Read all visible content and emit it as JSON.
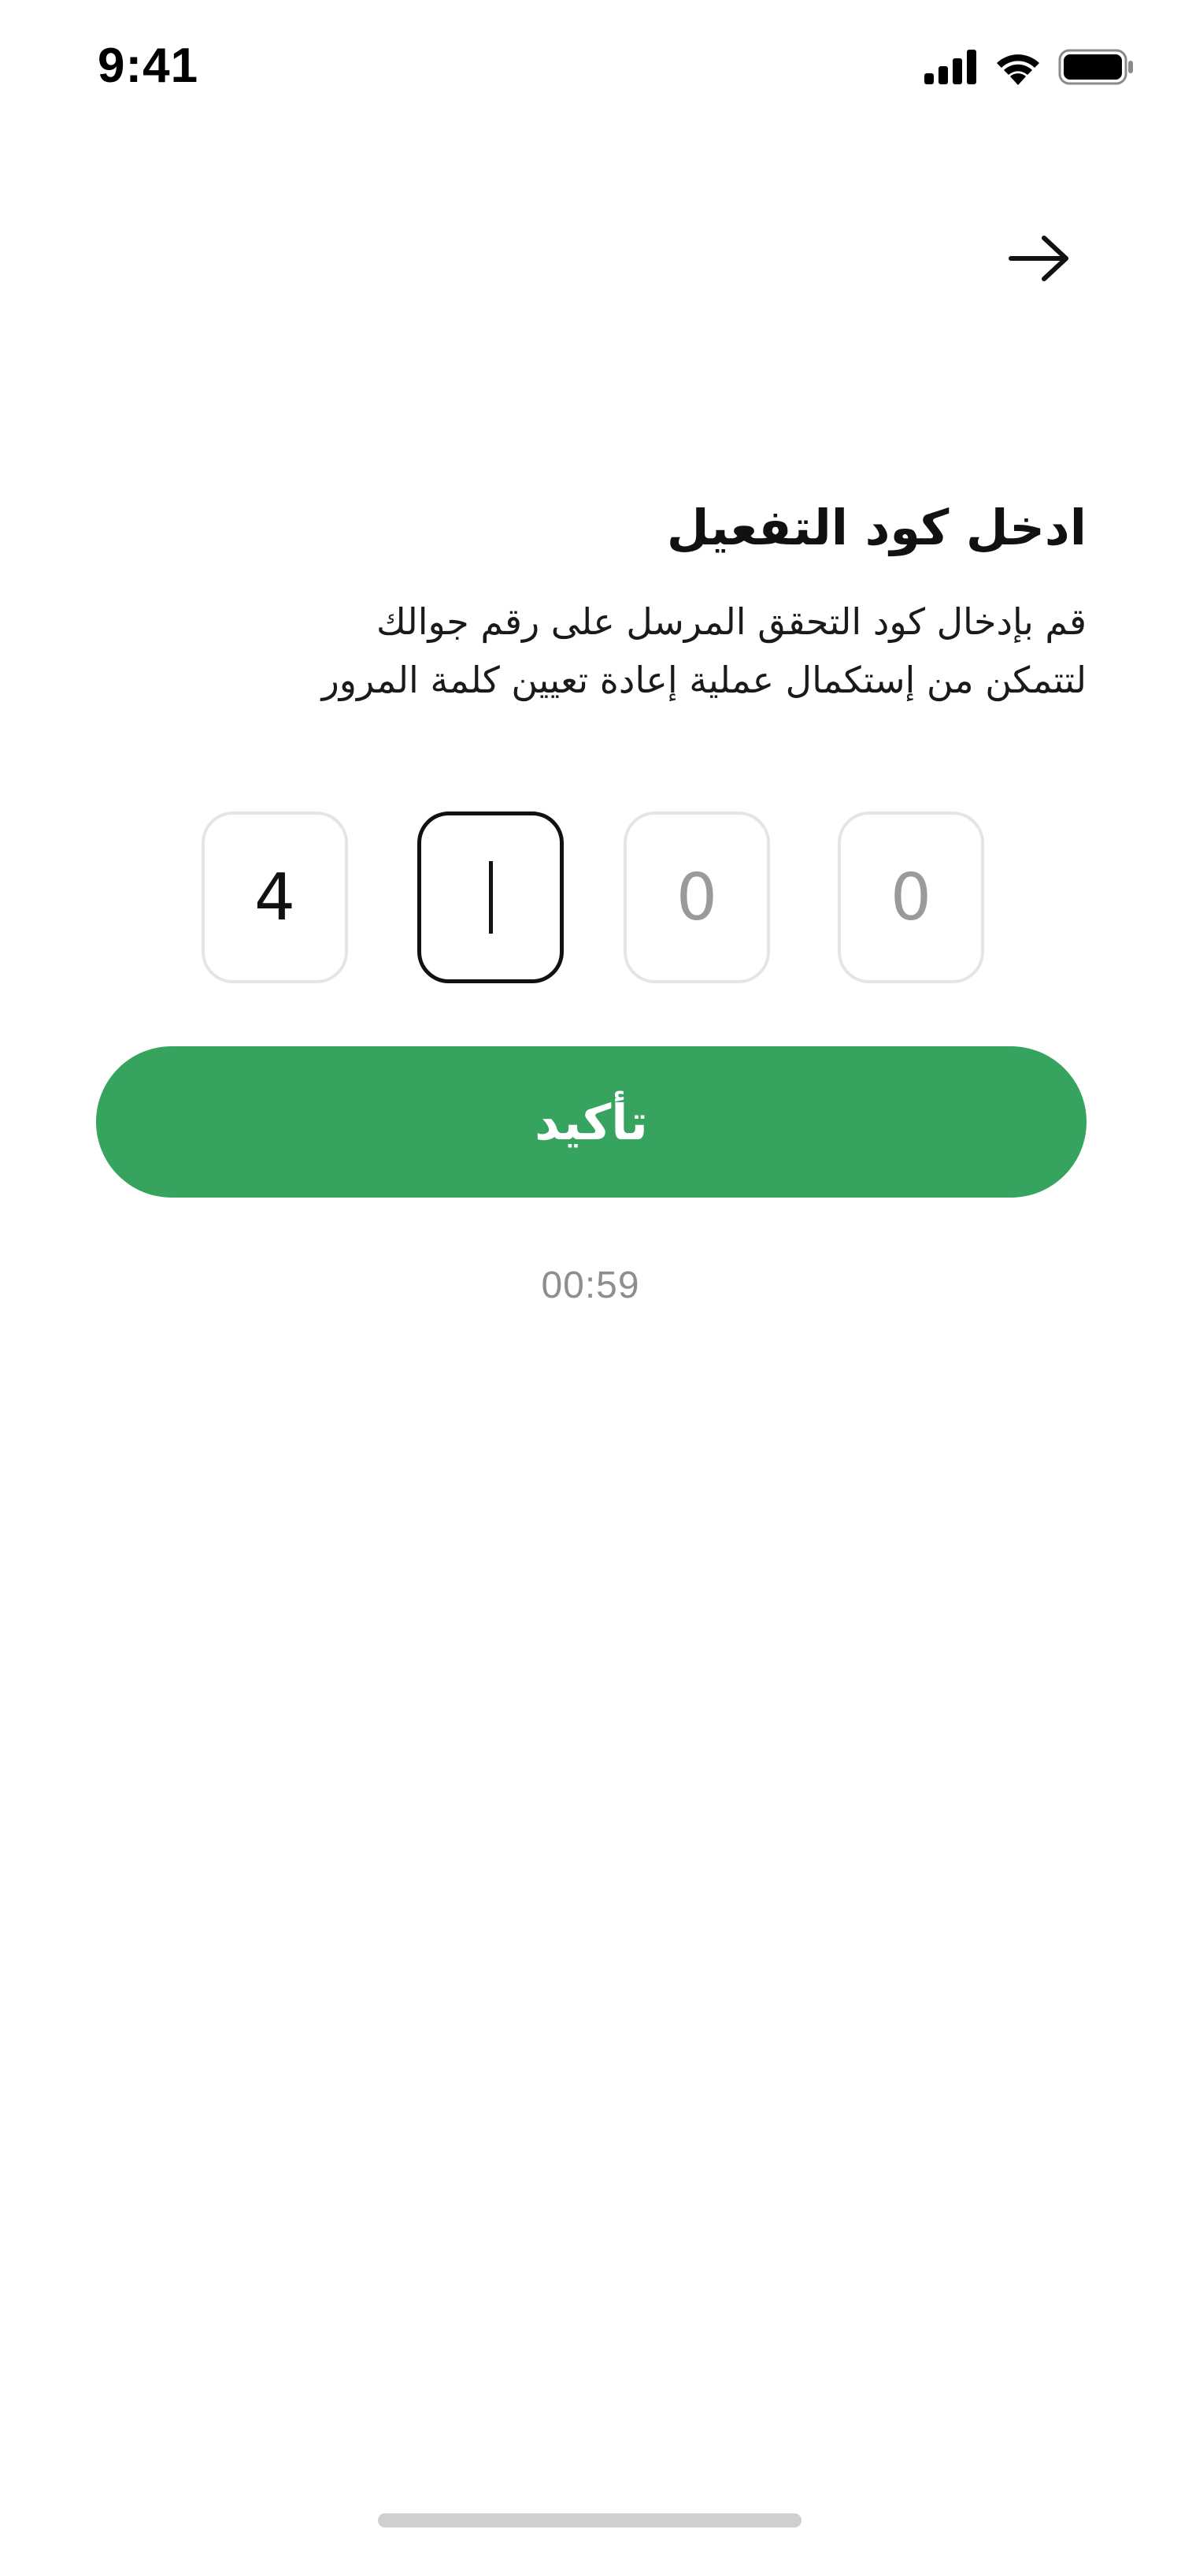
{
  "status_bar": {
    "time": "9:41",
    "icons": [
      "signal-icon",
      "wifi-icon",
      "battery-icon"
    ]
  },
  "header": {
    "back_icon": "arrow-right-icon"
  },
  "content": {
    "title": "ادخل كود التفعيل",
    "subtitle_line1": "قم بإدخال كود التحقق المرسل على رقم جوالك",
    "subtitle_line2": "لتتمكن من إستكمال عملية إعادة تعيين كلمة المرور"
  },
  "otp": {
    "digits": [
      "4",
      "",
      "0",
      "0"
    ],
    "active_index": 1
  },
  "confirm_button": {
    "label": "تأكيد"
  },
  "timer": {
    "value": "00:59"
  },
  "colors": {
    "accent": "#36a45e",
    "text": "#111111",
    "muted": "#8e8e8e",
    "box_border": "#e5e5e5"
  }
}
